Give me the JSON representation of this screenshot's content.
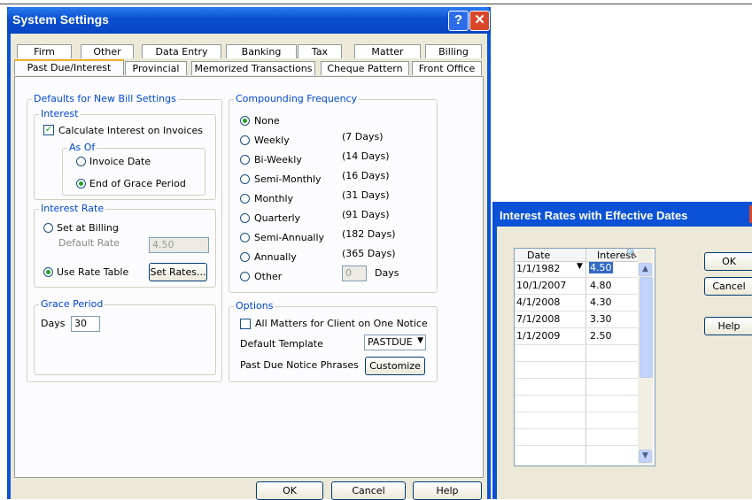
{
  "window": {
    "title": "System Settings"
  },
  "tabs_row1": [
    "Firm",
    "Other",
    "Data Entry",
    "Banking",
    "Tax",
    "Matter",
    "Billing"
  ],
  "tabs_row2": [
    "Past Due/Interest",
    "Provincial",
    "Memorized Transactions",
    "Cheque Pattern",
    "Front Office"
  ],
  "defaults": {
    "title": "Defaults for New Bill Settings",
    "interest_title": "Interest",
    "calc_interest_label": "Calculate Interest on Invoices",
    "as_of_title": "As Of",
    "invoice_date_label": "Invoice Date",
    "end_grace_label": "End of Grace Period"
  },
  "interest_rate": {
    "title": "Interest Rate",
    "set_at_billing_label": "Set at Billing",
    "default_rate_label": "Default Rate",
    "default_rate_value": "4.50",
    "use_rate_table_label": "Use Rate Table",
    "set_rates_button": "Set Rates..."
  },
  "grace": {
    "title": "Grace Period",
    "days_label": "Days",
    "days_value": "30"
  },
  "compounding": {
    "title": "Compounding Frequency",
    "options": [
      {
        "label": "None",
        "days": ""
      },
      {
        "label": "Weekly",
        "days": "(7 Days)"
      },
      {
        "label": "Bi-Weekly",
        "days": "(14 Days)"
      },
      {
        "label": "Semi-Monthly",
        "days": "(16 Days)"
      },
      {
        "label": "Monthly",
        "days": "(31 Days)"
      },
      {
        "label": "Quarterly",
        "days": "(91 Days)"
      },
      {
        "label": "Semi-Annually",
        "days": "(182 Days)"
      },
      {
        "label": "Annually",
        "days": "(365 Days)"
      },
      {
        "label": "Other",
        "days": ""
      }
    ],
    "other_value": "0",
    "other_days_label": "Days"
  },
  "options": {
    "title": "Options",
    "all_matters_label": "All Matters for Client on One Notice",
    "default_template_label": "Default Template",
    "default_template_value": "PASTDUE",
    "phrases_label": "Past Due Notice Phrases",
    "customize_button": "Customize"
  },
  "footer": {
    "ok": "OK",
    "cancel": "Cancel",
    "help": "Help"
  },
  "rates_dialog": {
    "title": "Interest Rates with Effective Dates",
    "col_date": "Date",
    "col_interest": "Interest",
    "rows": [
      {
        "date": "1/1/1982",
        "interest": "4.50"
      },
      {
        "date": "10/1/2007",
        "interest": "4.80"
      },
      {
        "date": "4/1/2008",
        "interest": "4.30"
      },
      {
        "date": "7/1/2008",
        "interest": "3.30"
      },
      {
        "date": "1/1/2009",
        "interest": "2.50"
      }
    ],
    "ok": "OK",
    "cancel": "Cancel",
    "help": "Help"
  }
}
